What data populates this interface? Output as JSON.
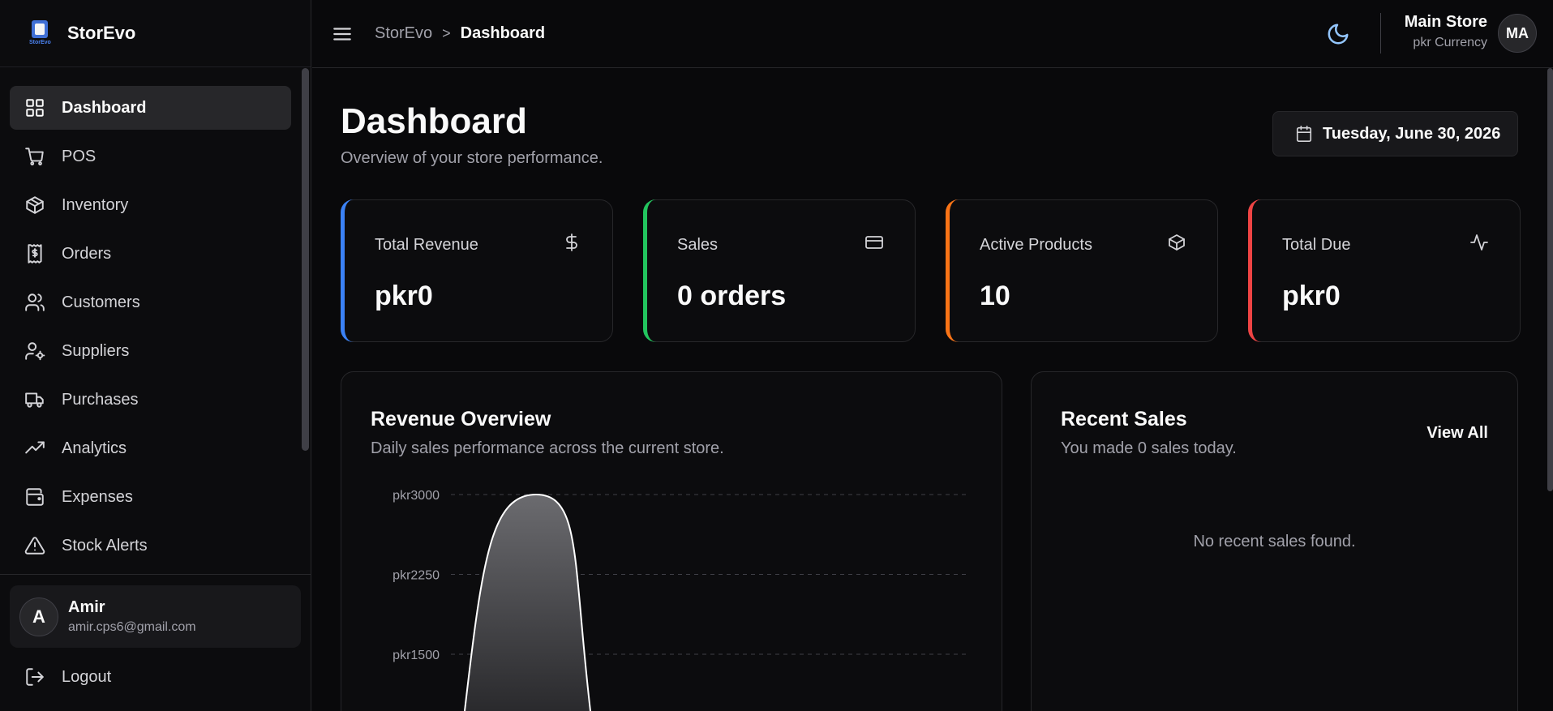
{
  "brand": {
    "name": "StorEvo",
    "logo_text": "StorEvo"
  },
  "sidebar": {
    "items": [
      {
        "label": "Dashboard",
        "icon": "grid-icon",
        "active": true
      },
      {
        "label": "POS",
        "icon": "cart-icon"
      },
      {
        "label": "Inventory",
        "icon": "box-icon"
      },
      {
        "label": "Orders",
        "icon": "receipt-icon"
      },
      {
        "label": "Customers",
        "icon": "users-icon"
      },
      {
        "label": "Suppliers",
        "icon": "user-cog-icon"
      },
      {
        "label": "Purchases",
        "icon": "truck-icon"
      },
      {
        "label": "Analytics",
        "icon": "trending-up-icon"
      },
      {
        "label": "Expenses",
        "icon": "wallet-icon"
      },
      {
        "label": "Stock Alerts",
        "icon": "alert-triangle-icon"
      }
    ],
    "user": {
      "initial": "A",
      "name": "Amir",
      "email": "amir.cps6@gmail.com"
    },
    "logout_label": "Logout"
  },
  "header": {
    "breadcrumb_root": "StorEvo",
    "breadcrumb_sep": ">",
    "breadcrumb_current": "Dashboard",
    "store_name": "Main Store",
    "store_currency": "pkr Currency",
    "store_initials": "MA"
  },
  "main": {
    "title": "Dashboard",
    "subtitle": "Overview of your store performance.",
    "date": "Tuesday, June 30, 2026",
    "stats": [
      {
        "label": "Total Revenue",
        "value": "pkr0",
        "accent": "#3b82f6",
        "icon": "dollar-icon"
      },
      {
        "label": "Sales",
        "value": "0 orders",
        "accent": "#22c55e",
        "icon": "credit-card-icon"
      },
      {
        "label": "Active Products",
        "value": "10",
        "accent": "#f97316",
        "icon": "package-icon"
      },
      {
        "label": "Total Due",
        "value": "pkr0",
        "accent": "#ef4444",
        "icon": "activity-icon"
      }
    ],
    "revenue": {
      "title": "Revenue Overview",
      "subtitle": "Daily sales performance across the current store."
    },
    "recent": {
      "title": "Recent Sales",
      "subtitle": "You made 0 sales today.",
      "view_all": "View All",
      "empty": "No recent sales found."
    }
  },
  "chart_data": {
    "type": "area",
    "title": "Revenue Overview",
    "y_tick_labels": [
      "pkr3000",
      "pkr2250",
      "pkr1500"
    ],
    "y_ticks": [
      3000,
      2250,
      1500
    ],
    "peak_value": 3000,
    "grid": true,
    "series_color": "#ffffff"
  }
}
